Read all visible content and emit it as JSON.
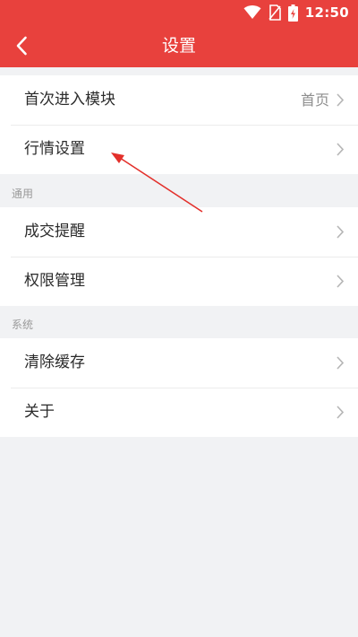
{
  "status_bar": {
    "time": "12:50",
    "icons": [
      "wifi-icon",
      "no-sim-icon",
      "battery-charging-icon"
    ]
  },
  "nav": {
    "title": "设置",
    "back_icon": "chevron-left-icon"
  },
  "colors": {
    "header": "#e8413d",
    "page_background": "#f1f2f4",
    "annotation_arrow": "#e3302b"
  },
  "groups": [
    {
      "section_label": "",
      "items": [
        {
          "label": "首次进入模块",
          "value": "首页"
        },
        {
          "label": "行情设置",
          "value": ""
        }
      ]
    },
    {
      "section_label": "通用",
      "items": [
        {
          "label": "成交提醒",
          "value": ""
        },
        {
          "label": "权限管理",
          "value": ""
        }
      ]
    },
    {
      "section_label": "系统",
      "items": [
        {
          "label": "清除缓存",
          "value": ""
        },
        {
          "label": "关于",
          "value": ""
        }
      ]
    }
  ]
}
